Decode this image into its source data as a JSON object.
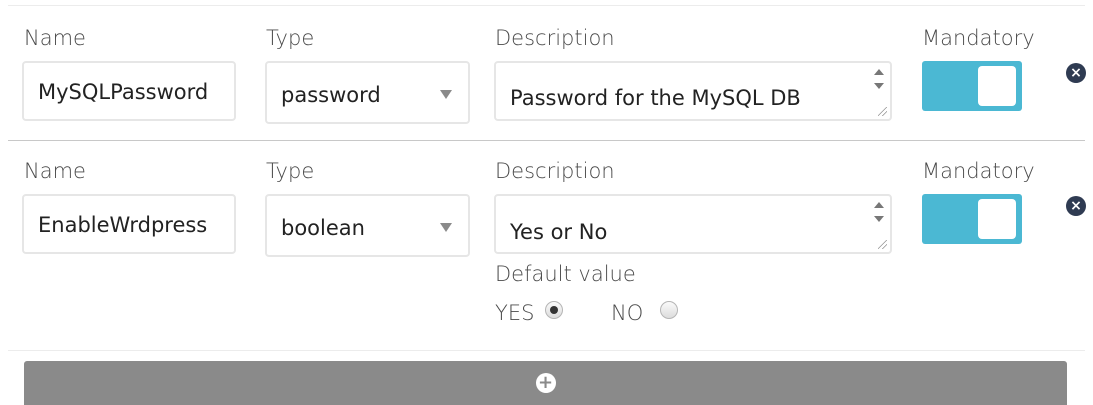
{
  "labels": {
    "name": "Name",
    "type": "Type",
    "description": "Description",
    "mandatory": "Mandatory",
    "default_value": "Default value"
  },
  "params": [
    {
      "name": "MySQLPassword",
      "type": "password",
      "description": "Password for the MySQL DB",
      "mandatory": true
    },
    {
      "name": "EnableWrdpress",
      "type": "boolean",
      "description": "Yes or No",
      "mandatory": true,
      "default_options": [
        {
          "label": "YES",
          "selected": true
        },
        {
          "label": "NO",
          "selected": false
        }
      ]
    }
  ],
  "icons": {
    "remove": "close-circle-icon",
    "add": "plus-circle-icon",
    "remove_glyph": "×",
    "add_glyph": "+"
  },
  "colors": {
    "toggle_on": "#4bb8d3",
    "add_bar": "#8a8a8a",
    "remove_icon": "#2f3b52"
  }
}
